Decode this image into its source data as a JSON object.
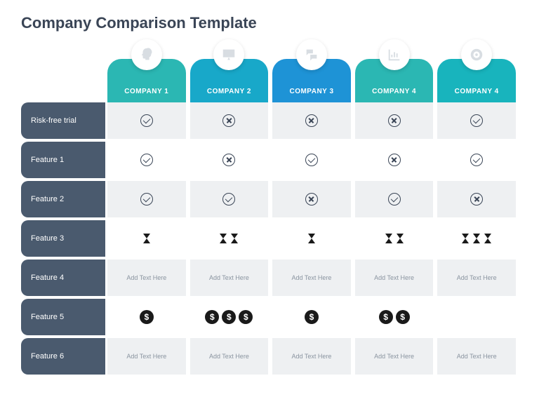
{
  "title": "Company Comparison Template",
  "columns": [
    {
      "label": "COMPANY 1",
      "color": "#2bb7b3",
      "icon": "head"
    },
    {
      "label": "COMPANY 2",
      "color": "#18a8c9",
      "icon": "board"
    },
    {
      "label": "COMPANY 3",
      "color": "#1e93d6",
      "icon": "chat"
    },
    {
      "label": "COMPANY 4",
      "color": "#2bb7b3",
      "icon": "chart"
    },
    {
      "label": "COMPANY 4",
      "color": "#18b4bd",
      "icon": "target"
    }
  ],
  "rows": [
    {
      "label": "Risk-free trial",
      "cells": [
        {
          "type": "mark",
          "value": "check"
        },
        {
          "type": "mark",
          "value": "cross"
        },
        {
          "type": "mark",
          "value": "cross"
        },
        {
          "type": "mark",
          "value": "cross"
        },
        {
          "type": "mark",
          "value": "check"
        }
      ]
    },
    {
      "label": "Feature 1",
      "cells": [
        {
          "type": "mark",
          "value": "check"
        },
        {
          "type": "mark",
          "value": "cross"
        },
        {
          "type": "mark",
          "value": "check"
        },
        {
          "type": "mark",
          "value": "cross"
        },
        {
          "type": "mark",
          "value": "check"
        }
      ]
    },
    {
      "label": "Feature 2",
      "cells": [
        {
          "type": "mark",
          "value": "check"
        },
        {
          "type": "mark",
          "value": "check"
        },
        {
          "type": "mark",
          "value": "cross"
        },
        {
          "type": "mark",
          "value": "check"
        },
        {
          "type": "mark",
          "value": "cross"
        }
      ]
    },
    {
      "label": "Feature 3",
      "cells": [
        {
          "type": "hour",
          "count": 1
        },
        {
          "type": "hour",
          "count": 2
        },
        {
          "type": "hour",
          "count": 1
        },
        {
          "type": "hour",
          "count": 2
        },
        {
          "type": "hour",
          "count": 3
        }
      ]
    },
    {
      "label": "Feature 4",
      "cells": [
        {
          "type": "text",
          "value": "Add Text Here"
        },
        {
          "type": "text",
          "value": "Add Text Here"
        },
        {
          "type": "text",
          "value": "Add Text Here"
        },
        {
          "type": "text",
          "value": "Add Text Here"
        },
        {
          "type": "text",
          "value": "Add Text Here"
        }
      ]
    },
    {
      "label": "Feature 5",
      "cells": [
        {
          "type": "dollar",
          "count": 1
        },
        {
          "type": "dollar",
          "count": 3
        },
        {
          "type": "dollar",
          "count": 1
        },
        {
          "type": "dollar",
          "count": 2
        },
        {
          "type": "blank"
        }
      ]
    },
    {
      "label": "Feature 6",
      "cells": [
        {
          "type": "text",
          "value": "Add Text Here"
        },
        {
          "type": "text",
          "value": "Add Text Here"
        },
        {
          "type": "text",
          "value": "Add Text Here"
        },
        {
          "type": "text",
          "value": "Add Text Here"
        },
        {
          "type": "text",
          "value": "Add Text Here"
        }
      ]
    }
  ]
}
